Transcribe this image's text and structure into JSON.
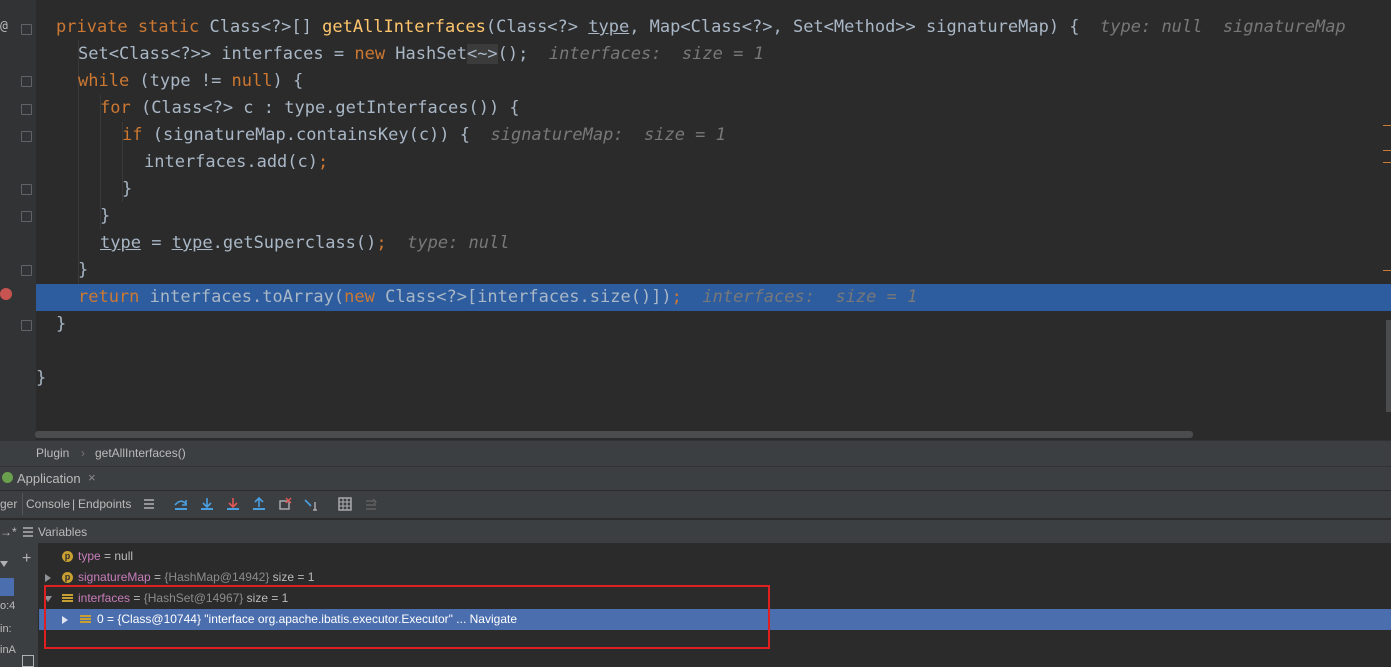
{
  "editor": {
    "signature": {
      "mod": "private static ",
      "ret": "Class<?>[] ",
      "name": "getAllInterfaces",
      "p1": "(Class<?> ",
      "p1name": "type",
      "p2": ", Map<Class<?>, Set<Method>> signatureMap) {",
      "hint": "type: null  signatureMap"
    },
    "l2": {
      "a": "Set<Class<?>> interfaces = ",
      "kw": "new",
      "b": " HashSet",
      "c": "<~>",
      "d": "();",
      "hint": "interfaces:  size = 1"
    },
    "l3": {
      "kw": "while",
      "b": " (type != ",
      "kw2": "null",
      "c": ") {"
    },
    "l4": {
      "kw": "for",
      "b": " (Class<?> c : type.getInterfaces()) {"
    },
    "l5": {
      "kw": "if",
      "b": " (signatureMap.containsKey(c)) {",
      "hint": "signatureMap:  size = 1"
    },
    "l6": {
      "a": "interfaces.add(c)",
      "b": ";"
    },
    "l7": "}",
    "l8": "}",
    "l9": {
      "t1": "type",
      "eq": " = ",
      "t2": "type",
      "b": ".getSuperclass()",
      "c": ";",
      "hint": "type: null"
    },
    "l10": "}",
    "l11": {
      "kw": "return",
      "b": " interfaces.toArray(",
      "kw2": "new",
      "c": " Class<?>[interfaces.size()])",
      "d": ";",
      "hint": "interfaces:  size = 1"
    },
    "l12": "}",
    "l14": "}"
  },
  "breadcrumb": {
    "class": "Plugin",
    "method": "getAllInterfaces()"
  },
  "debug": {
    "tab": "Application",
    "close": "×",
    "side_tab": "ger",
    "console_tab": "Console",
    "endpoints_tab": "Endpoints",
    "variables_label": "Variables",
    "side_items": [
      "o:4",
      "in:",
      "inA"
    ]
  },
  "variables": [
    {
      "badge": "p",
      "name": "type",
      "eq": " = ",
      "value": "null",
      "type": "",
      "extra": ""
    },
    {
      "badge": "p",
      "name": "signatureMap",
      "eq": " = ",
      "value": "",
      "type": "{HashMap@14942}",
      "extra": "  size = 1"
    },
    {
      "badge": "f",
      "name": "interfaces",
      "eq": " = ",
      "value": "",
      "type": "{HashSet@14967}",
      "extra": "  size = 1"
    },
    {
      "badge": "f",
      "name": "0",
      "eq": " = ",
      "value": "{Class@10744} \"interface org.apache.ibatis.executor.Executor\"",
      "type": "",
      "extra": "... Navigate"
    }
  ],
  "colors": {
    "keyword": "#cc7832",
    "method": "#ffc66d",
    "selection": "#2d5d9f",
    "highlight_box": "#e02020"
  }
}
